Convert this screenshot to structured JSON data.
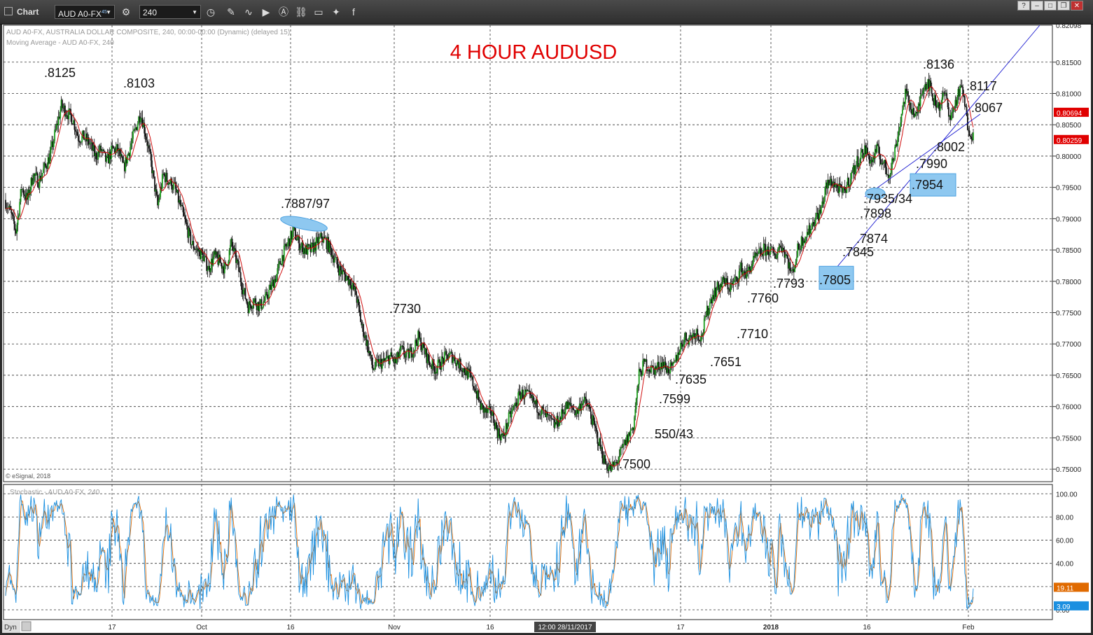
{
  "toolbar": {
    "title": "Chart",
    "symbol": "AUD A0-FX",
    "symbol_superscript": "45",
    "interval": "240",
    "icons": [
      "settings-icon",
      "clock-icon",
      "pencil-icon",
      "wave-icon",
      "play-icon",
      "a-icon",
      "link-icon",
      "comment-icon",
      "twitter-icon",
      "facebook-icon"
    ]
  },
  "chart_data": {
    "type": "candlestick",
    "title": "4 HOUR AUDUSD",
    "price_panel": {
      "header_line1": "AUD A0-FX, AUSTRALIA DOLLAR COMPOSITE, 240, 00:00-00:00 (Dynamic) (delayed 15)",
      "header_line2": "Moving Average - AUD A0-FX, 240",
      "footer": "© eSignal, 2018",
      "ylim": [
        0.748,
        0.8209
      ],
      "y_ticks": [
        "0.75000",
        "0.75500",
        "0.76000",
        "0.76500",
        "0.77000",
        "0.77500",
        "0.78000",
        "0.78500",
        "0.79000",
        "0.79500",
        "0.80000",
        "0.80500",
        "0.81000",
        "0.81500"
      ],
      "y_top_label": "0.82098",
      "last_price_labels": [
        {
          "value": 0.80694,
          "text": "0.80694",
          "color": "#e00000"
        },
        {
          "value": 0.80259,
          "text": "0.80259",
          "color": "#e00000"
        }
      ],
      "close_path": [
        [
          0,
          0.793
        ],
        [
          1,
          0.791
        ],
        [
          2,
          0.788
        ],
        [
          3,
          0.795
        ],
        [
          4,
          0.793
        ],
        [
          5,
          0.797
        ],
        [
          6,
          0.796
        ],
        [
          7,
          0.798
        ],
        [
          8,
          0.8
        ],
        [
          9,
          0.804
        ],
        [
          10,
          0.808
        ],
        [
          11,
          0.807
        ],
        [
          12,
          0.806
        ],
        [
          13,
          0.803
        ],
        [
          14,
          0.803
        ],
        [
          15,
          0.802
        ],
        [
          16,
          0.8
        ],
        [
          17,
          0.801
        ],
        [
          18,
          0.799
        ],
        [
          19,
          0.801
        ],
        [
          20,
          0.801
        ],
        [
          21,
          0.798
        ],
        [
          22,
          0.801
        ],
        [
          23,
          0.804
        ],
        [
          24,
          0.807
        ],
        [
          25,
          0.803
        ],
        [
          26,
          0.798
        ],
        [
          27,
          0.792
        ],
        [
          28,
          0.797
        ],
        [
          29,
          0.796
        ],
        [
          30,
          0.795
        ],
        [
          31,
          0.792
        ],
        [
          32,
          0.789
        ],
        [
          33,
          0.786
        ],
        [
          34,
          0.785
        ],
        [
          35,
          0.784
        ],
        [
          36,
          0.782
        ],
        [
          37,
          0.784
        ],
        [
          38,
          0.783
        ],
        [
          39,
          0.782
        ],
        [
          40,
          0.786
        ],
        [
          41,
          0.783
        ],
        [
          42,
          0.779
        ],
        [
          43,
          0.776
        ],
        [
          44,
          0.777
        ],
        [
          45,
          0.776
        ],
        [
          46,
          0.777
        ],
        [
          47,
          0.779
        ],
        [
          48,
          0.781
        ],
        [
          49,
          0.784
        ],
        [
          50,
          0.786
        ],
        [
          51,
          0.788
        ],
        [
          52,
          0.786
        ],
        [
          53,
          0.785
        ],
        [
          54,
          0.785
        ],
        [
          55,
          0.786
        ],
        [
          56,
          0.787
        ],
        [
          57,
          0.786
        ],
        [
          58,
          0.784
        ],
        [
          59,
          0.782
        ],
        [
          60,
          0.781
        ],
        [
          61,
          0.78
        ],
        [
          62,
          0.778
        ],
        [
          63,
          0.773
        ],
        [
          64,
          0.77
        ],
        [
          65,
          0.766
        ],
        [
          66,
          0.767
        ],
        [
          67,
          0.767
        ],
        [
          68,
          0.768
        ],
        [
          69,
          0.767
        ],
        [
          70,
          0.769
        ],
        [
          71,
          0.768
        ],
        [
          72,
          0.769
        ],
        [
          73,
          0.771
        ],
        [
          74,
          0.769
        ],
        [
          75,
          0.767
        ],
        [
          76,
          0.766
        ],
        [
          77,
          0.767
        ],
        [
          78,
          0.768
        ],
        [
          79,
          0.768
        ],
        [
          80,
          0.767
        ],
        [
          81,
          0.766
        ],
        [
          82,
          0.765
        ],
        [
          83,
          0.763
        ],
        [
          84,
          0.76
        ],
        [
          85,
          0.759
        ],
        [
          86,
          0.759
        ],
        [
          87,
          0.756
        ],
        [
          88,
          0.755
        ],
        [
          89,
          0.758
        ],
        [
          90,
          0.76
        ],
        [
          91,
          0.762
        ],
        [
          92,
          0.762
        ],
        [
          93,
          0.761
        ],
        [
          94,
          0.76
        ],
        [
          95,
          0.759
        ],
        [
          96,
          0.758
        ],
        [
          97,
          0.757
        ],
        [
          98,
          0.758
        ],
        [
          99,
          0.76
        ],
        [
          100,
          0.76
        ],
        [
          101,
          0.759
        ],
        [
          102,
          0.761
        ],
        [
          103,
          0.76
        ],
        [
          104,
          0.757
        ],
        [
          105,
          0.754
        ],
        [
          106,
          0.751
        ],
        [
          107,
          0.75
        ],
        [
          108,
          0.751
        ],
        [
          109,
          0.753
        ],
        [
          110,
          0.755
        ],
        [
          111,
          0.757
        ],
        [
          112,
          0.765
        ],
        [
          113,
          0.767
        ],
        [
          114,
          0.766
        ],
        [
          115,
          0.766
        ],
        [
          116,
          0.767
        ],
        [
          117,
          0.766
        ],
        [
          118,
          0.766
        ],
        [
          119,
          0.769
        ],
        [
          120,
          0.771
        ],
        [
          121,
          0.771
        ],
        [
          122,
          0.772
        ],
        [
          123,
          0.771
        ],
        [
          124,
          0.775
        ],
        [
          125,
          0.778
        ],
        [
          126,
          0.779
        ],
        [
          127,
          0.78
        ],
        [
          128,
          0.779
        ],
        [
          129,
          0.78
        ],
        [
          130,
          0.782
        ],
        [
          131,
          0.781
        ],
        [
          132,
          0.783
        ],
        [
          133,
          0.784
        ],
        [
          134,
          0.785
        ],
        [
          135,
          0.785
        ],
        [
          136,
          0.784
        ],
        [
          137,
          0.786
        ],
        [
          138,
          0.784
        ],
        [
          139,
          0.781
        ],
        [
          140,
          0.785
        ],
        [
          141,
          0.787
        ],
        [
          142,
          0.788
        ],
        [
          143,
          0.79
        ],
        [
          144,
          0.791
        ],
        [
          145,
          0.795
        ],
        [
          146,
          0.796
        ],
        [
          147,
          0.795
        ],
        [
          148,
          0.794
        ],
        [
          149,
          0.796
        ],
        [
          150,
          0.798
        ],
        [
          151,
          0.8
        ],
        [
          152,
          0.801
        ],
        [
          153,
          0.799
        ],
        [
          154,
          0.801
        ],
        [
          155,
          0.799
        ],
        [
          156,
          0.797
        ],
        [
          157,
          0.8
        ],
        [
          158,
          0.805
        ],
        [
          159,
          0.81
        ],
        [
          160,
          0.808
        ],
        [
          161,
          0.806
        ],
        [
          162,
          0.811
        ],
        [
          163,
          0.812
        ],
        [
          164,
          0.809
        ],
        [
          165,
          0.808
        ],
        [
          166,
          0.81
        ],
        [
          167,
          0.806
        ],
        [
          168,
          0.809
        ],
        [
          169,
          0.811
        ],
        [
          170,
          0.805
        ],
        [
          171,
          0.803
        ]
      ],
      "annotations": [
        {
          "label": ".8125",
          "value": 0.8125
        },
        {
          "label": ".8103",
          "value": 0.8103
        },
        {
          "label": ".7887/97",
          "value": 0.7897
        },
        {
          "label": ".7730",
          "value": 0.773
        },
        {
          "label": ".7500",
          "value": 0.75
        },
        {
          "label": "550/43",
          "value": 0.755
        },
        {
          "label": ".7599",
          "value": 0.7599
        },
        {
          "label": ".7635",
          "value": 0.7635
        },
        {
          "label": ".7651",
          "value": 0.7651
        },
        {
          "label": ".7710",
          "value": 0.771
        },
        {
          "label": ".7760",
          "value": 0.776
        },
        {
          "label": ".7793",
          "value": 0.7793
        },
        {
          "label": ".7805",
          "value": 0.7805
        },
        {
          "label": ".7845",
          "value": 0.7845
        },
        {
          "label": ".7874",
          "value": 0.7874
        },
        {
          "label": ".7898",
          "value": 0.7898
        },
        {
          "label": ".7935/34",
          "value": 0.7935
        },
        {
          "label": ".7954",
          "value": 0.7954
        },
        {
          "label": ".7990",
          "value": 0.799
        },
        {
          "label": ".8002",
          "value": 0.8002
        },
        {
          "label": ".8136",
          "value": 0.8136
        },
        {
          "label": ".8117",
          "value": 0.8117
        },
        {
          "label": ".8067",
          "value": 0.8067
        }
      ]
    },
    "stochastic_panel": {
      "header": "Stochastic - AUD A0-FX, 240",
      "ylim": [
        0,
        108
      ],
      "y_ticks": [
        "0.00",
        "20.00",
        "40.00",
        "60.00",
        "80.00",
        "100.00"
      ],
      "last_labels": [
        {
          "value": 19.11,
          "text": "19.11",
          "color": "#e06a00"
        },
        {
          "value": 3.09,
          "text": "3.09",
          "color": "#1a8fe0"
        }
      ]
    },
    "x_axis": {
      "tick_labels": [
        "17",
        "Oct",
        "16",
        "Nov",
        "16",
        "17",
        "2018",
        "16",
        "Feb"
      ],
      "crosshair_label": "12:00 28/11/2017",
      "corner_label": "Dyn"
    },
    "colors": {
      "background": "#ffffff",
      "up_candle": "#1a9c1a",
      "down_candle": "#111111",
      "moving_average": "#d01010",
      "trendline": "#1a1ad0",
      "highlight_fill": "#8ec8f0",
      "title": "#e00000",
      "stoch_k": "#1a8fe0",
      "stoch_d": "#e06a00"
    }
  }
}
